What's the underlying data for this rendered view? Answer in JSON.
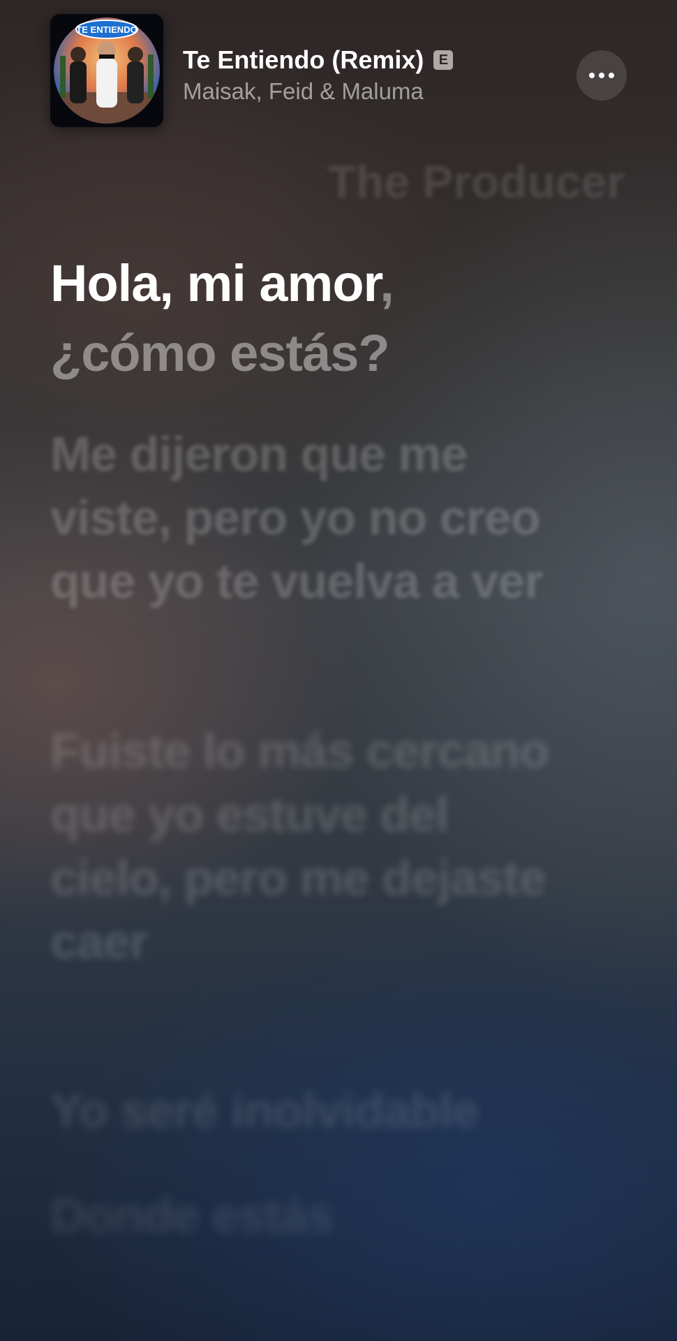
{
  "now_playing": {
    "title": "Te Entiendo (Remix)",
    "explicit_label": "E",
    "artist": "Maisak, Feid & Maluma",
    "artwork_text": "TE ENTIENDO"
  },
  "lyrics": {
    "credit": "The Producer",
    "active_line_sung": "Hola, mi amor",
    "active_line_unsung": ",",
    "next_line": "¿cómo estás?",
    "upcoming": [
      "Me dijeron que me viste, pero yo no creo que yo te vuelva a ver",
      "Fuiste lo más cercano que yo estuve del cielo, pero me dejaste caer",
      "Yo seré inolvidable",
      "Donde estás"
    ]
  },
  "colors": {
    "active_text": "#ffffff",
    "dimmed_text": "rgba(255,255,255,0.42)",
    "background_top": "#2f2626",
    "background_bottom": "#182336"
  },
  "icons": {
    "more": "ellipsis-icon",
    "explicit": "explicit-icon"
  }
}
